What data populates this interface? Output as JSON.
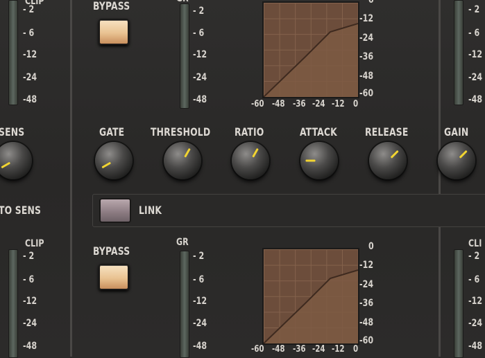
{
  "app": {
    "section_top": {
      "bypass_label": "BYPASS",
      "gr_label": "GR",
      "gr_scale": [
        "- 2",
        "- 6",
        "-12",
        "-24",
        "-48"
      ],
      "graph_y_scale": [
        "0",
        "-12",
        "-24",
        "-36",
        "-48",
        "-60"
      ],
      "graph_x_scale": [
        "-60",
        "-48",
        "-36",
        "-24",
        "-12",
        "0"
      ]
    },
    "left_column": {
      "clip_label": "CLIP",
      "scale_top": [
        "- 2",
        "- 6",
        "-12",
        "-24",
        "-48"
      ],
      "sens_label": "SENS",
      "auto_sens_label": "TO SENS",
      "scale_bottom": [
        "- 2",
        "- 6",
        "-12",
        "-24",
        "-48"
      ]
    },
    "knobs": [
      {
        "label": "GATE",
        "indicator_angle_deg": 240
      },
      {
        "label": "THRESHOLD",
        "indicator_angle_deg": 30
      },
      {
        "label": "RATIO",
        "indicator_angle_deg": 30
      },
      {
        "label": "ATTACK",
        "indicator_angle_deg": 270
      },
      {
        "label": "RELEASE",
        "indicator_angle_deg": 45
      },
      {
        "label": "GAIN",
        "indicator_angle_deg": 45
      }
    ],
    "link": {
      "label": "LINK"
    },
    "section_bottom": {
      "bypass_label": "BYPASS",
      "gr_label": "GR",
      "gr_scale": [
        "- 2",
        "- 6",
        "-12",
        "-24",
        "-48"
      ],
      "graph_y_scale": [
        "0",
        "-12",
        "-24",
        "-36",
        "-48",
        "-60"
      ],
      "graph_x_scale": [
        "-60",
        "-48",
        "-36",
        "-24",
        "-12",
        "0"
      ]
    },
    "right_column": {
      "clip_label": "CLI",
      "scale_top": [
        "- 2",
        "- 6",
        "-12",
        "-24",
        "-48"
      ],
      "scale_bottom": [
        "- 2",
        "- 6",
        "-12",
        "-24",
        "-48"
      ]
    },
    "colors": {
      "accent_knob_indicator": "#f1d431",
      "bypass_button": "#e9c392",
      "link_button": "#8b7a81",
      "graph_bg": "#6c4d3b"
    }
  }
}
